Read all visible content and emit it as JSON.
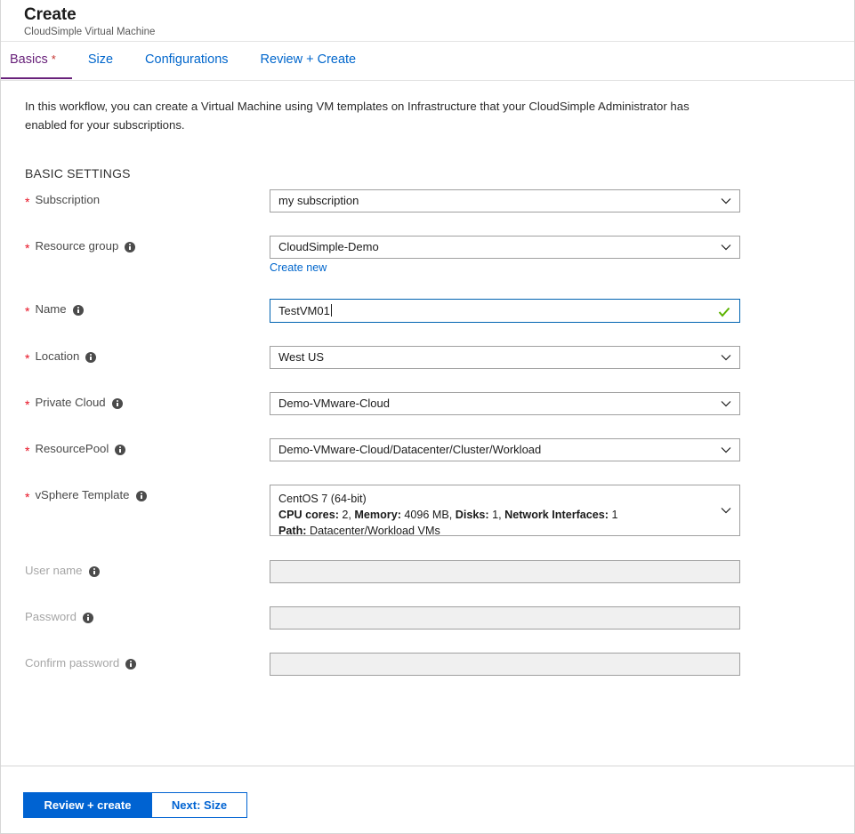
{
  "header": {
    "title": "Create",
    "subtitle": "CloudSimple Virtual Machine"
  },
  "tabs": [
    {
      "label": "Basics",
      "required_marker": "*",
      "active": true
    },
    {
      "label": "Size",
      "active": false
    },
    {
      "label": "Configurations",
      "active": false
    },
    {
      "label": "Review + Create",
      "active": false
    }
  ],
  "intro": "In this workflow, you can create a Virtual Machine using VM templates on Infrastructure that your CloudSimple Administrator has enabled for your subscriptions.",
  "section_title": "BASIC SETTINGS",
  "fields": {
    "subscription": {
      "label": "Subscription",
      "value": "my subscription"
    },
    "resource_group": {
      "label": "Resource group",
      "value": "CloudSimple-Demo",
      "sublink": "Create new"
    },
    "name": {
      "label": "Name",
      "value": "TestVM01"
    },
    "location": {
      "label": "Location",
      "value": "West US"
    },
    "private_cloud": {
      "label": "Private Cloud",
      "value": "Demo-VMware-Cloud"
    },
    "resource_pool": {
      "label": "ResourcePool",
      "value": "Demo-VMware-Cloud/Datacenter/Cluster/Workload"
    },
    "vsphere_template": {
      "label": "vSphere Template",
      "line1": "CentOS 7 (64-bit)",
      "cpu_key": "CPU cores:",
      "cpu_value": "2,",
      "memory_key": "Memory:",
      "memory_value": "4096 MB,",
      "disks_key": "Disks:",
      "disks_value": "1,",
      "nic_key": "Network Interfaces:",
      "nic_value": "1",
      "path_key": "Path:",
      "path_value": "Datacenter/Workload VMs"
    },
    "user_name": {
      "label": "User name",
      "value": ""
    },
    "password": {
      "label": "Password",
      "value": ""
    },
    "confirm_password": {
      "label": "Confirm password",
      "value": ""
    }
  },
  "footer": {
    "primary_button": "Review + create",
    "secondary_button": "Next: Size"
  },
  "colors": {
    "accent_blue": "#0063d2",
    "link_blue": "#0066cc",
    "active_tab_purple": "#68217a",
    "required_red": "#e81123",
    "valid_green": "#5cb300"
  }
}
